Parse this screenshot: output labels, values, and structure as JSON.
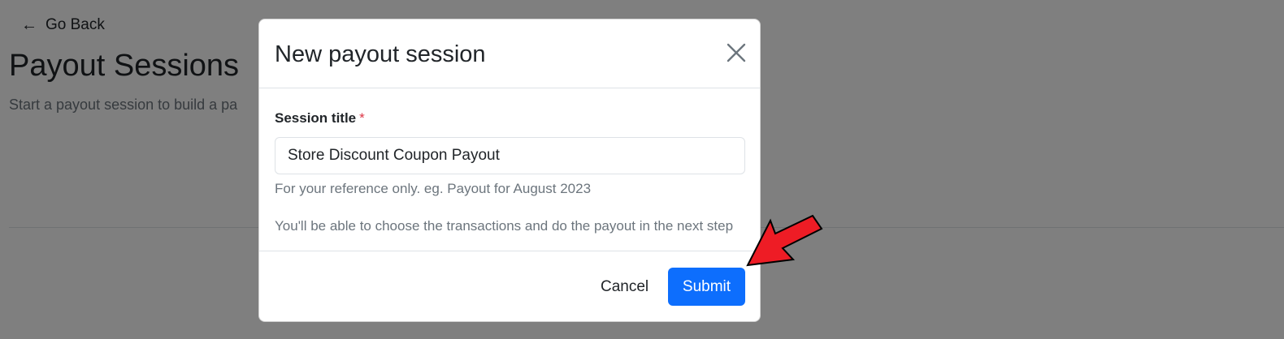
{
  "page": {
    "back_label": "Go Back",
    "back_icon": "arrow-left-icon",
    "title": "Payout Sessions",
    "subtitle": "Start a payout session to build a pa"
  },
  "modal": {
    "title": "New payout session",
    "close_icon": "close-icon",
    "field_label": "Session title",
    "required_mark": "*",
    "input_value": "Store Discount Coupon Payout",
    "help_text": "For your reference only. eg. Payout for August 2023",
    "note_text": "You'll be able to choose the transactions and do the payout in the next step",
    "cancel_label": "Cancel",
    "submit_label": "Submit"
  },
  "colors": {
    "primary": "#0d6efd",
    "required": "#dc3545",
    "annotation_arrow": "#ee1c25",
    "backdrop": "rgba(0,0,0,0.5)"
  },
  "annotation": {
    "icon": "red-arrow-icon"
  }
}
